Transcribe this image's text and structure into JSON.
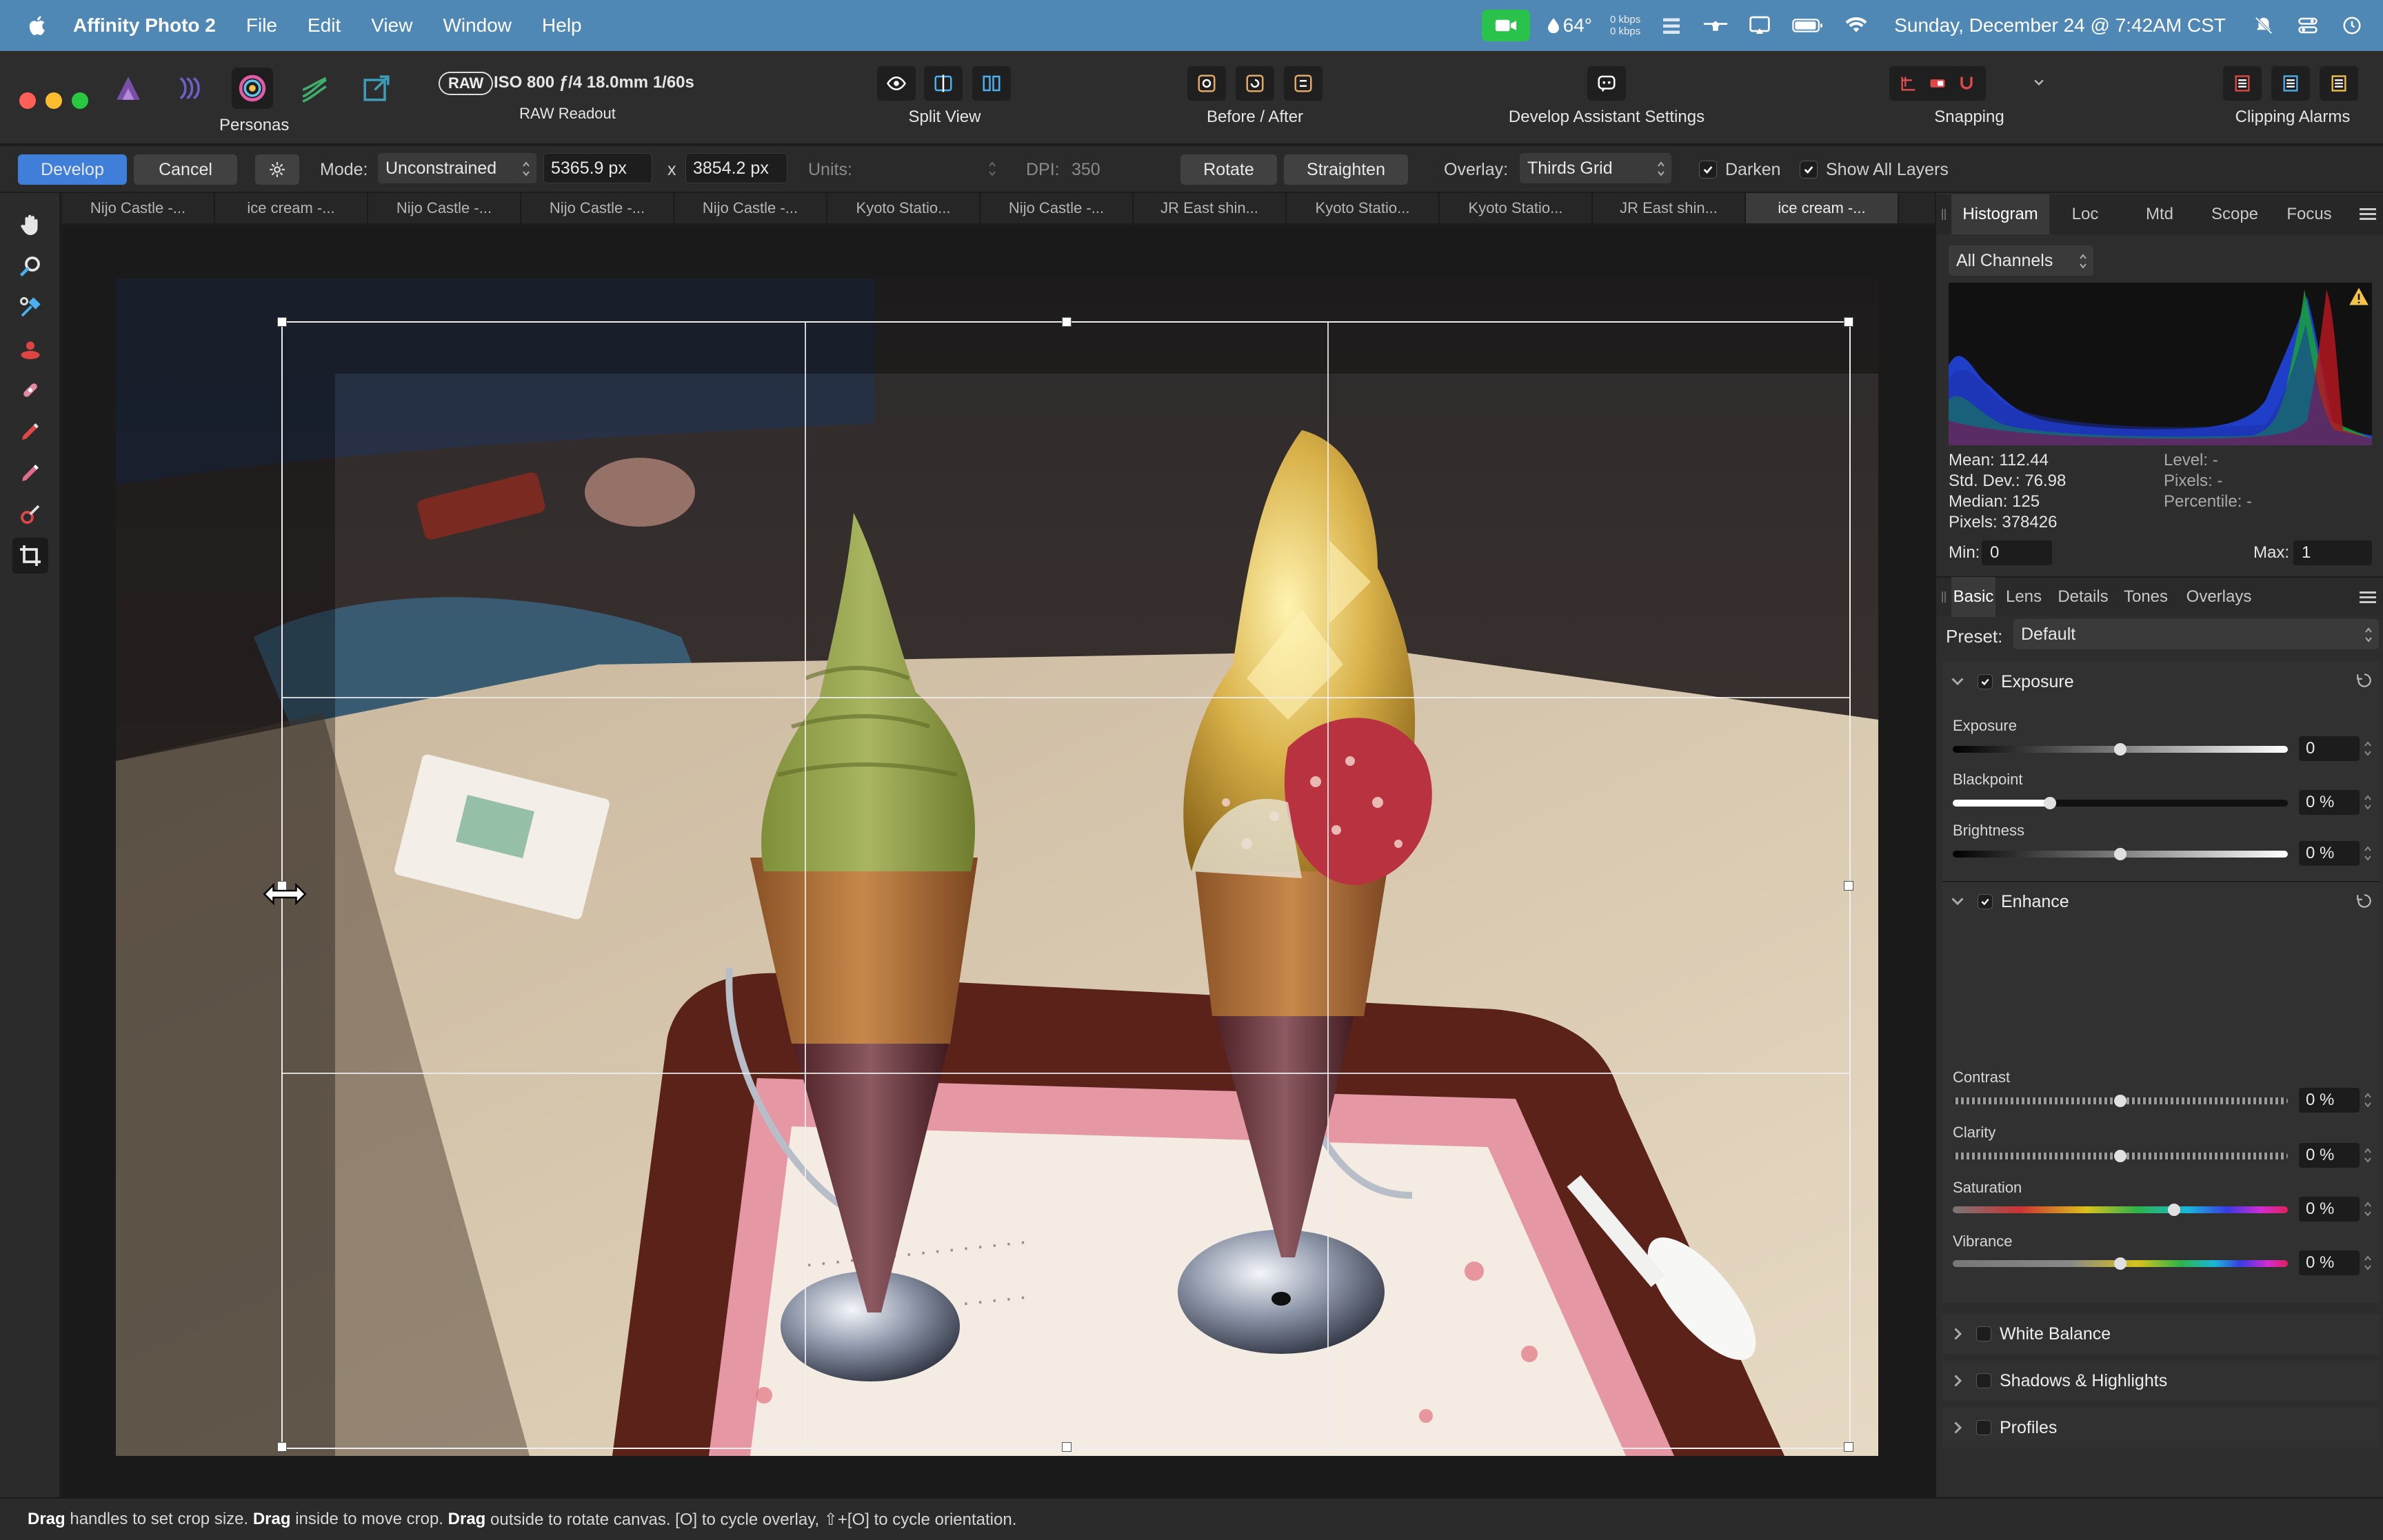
{
  "menubar": {
    "app_name": "Affinity Photo 2",
    "menus": [
      "File",
      "Edit",
      "View",
      "Window",
      "Help"
    ],
    "weather": "64°",
    "net_up": "0 kbps",
    "net_down": "0 kbps",
    "datetime": "Sunday, December 24 @ 7:42AM CST"
  },
  "toolbar": {
    "personas_label": "Personas",
    "raw_badge": "RAW",
    "raw_readout_value": "ISO 800 ƒ/4 18.0mm 1/60s",
    "raw_readout_label": "RAW Readout",
    "split_view_label": "Split View",
    "before_after_label": "Before / After",
    "assistant_label": "Develop Assistant Settings",
    "snapping_label": "Snapping",
    "clipping_label": "Clipping Alarms"
  },
  "context": {
    "develop_label": "Develop",
    "cancel_label": "Cancel",
    "mode_label": "Mode:",
    "mode_value": "Unconstrained",
    "width_value": "5365.9 px",
    "x_label": "x",
    "height_value": "3854.2 px",
    "units_label": "Units:",
    "dpi_label": "DPI:",
    "dpi_value": "350",
    "rotate_label": "Rotate",
    "straighten_label": "Straighten",
    "overlay_label": "Overlay:",
    "overlay_value": "Thirds Grid",
    "darken_label": "Darken",
    "show_layers_label": "Show All Layers"
  },
  "doc_tabs": [
    "Nijo Castle -...",
    "ice cream -...",
    "Nijo Castle -...",
    "Nijo Castle -...",
    "Nijo Castle -...",
    "Kyoto Statio...",
    "Nijo Castle -...",
    "JR East shin...",
    "Kyoto Statio...",
    "Kyoto Statio...",
    "JR East shin...",
    "ice cream -..."
  ],
  "status": {
    "w1": "Drag",
    "t1": " handles to set crop size. ",
    "w2": "Drag",
    "t2": " inside to move crop. ",
    "w3": "Drag",
    "t3": " outside to rotate canvas. [O] to cycle overlay, ⇧+[O] to cycle orientation."
  },
  "histogram": {
    "tabs": [
      "Histogram",
      "Loc",
      "Mtd",
      "Scope",
      "Focus"
    ],
    "channel": "All Channels",
    "mean": "Mean: 112.44",
    "stddev": "Std. Dev.: 76.98",
    "median": "Median: 125",
    "pixels": "Pixels: 378426",
    "level": "Level: -",
    "pixels_right": "Pixels: -",
    "percentile": "Percentile: -",
    "min_label": "Min:",
    "min_value": "0",
    "max_label": "Max:",
    "max_value": "1"
  },
  "develop_panel": {
    "tabs": [
      "Basic",
      "Lens",
      "Details",
      "Tones",
      "Overlays"
    ],
    "preset_label": "Preset:",
    "preset_value": "Default",
    "exposure": {
      "title": "Exposure",
      "sliders": [
        {
          "label": "Exposure",
          "value": "0",
          "pos": 0.5
        },
        {
          "label": "Blackpoint",
          "value": "0 %",
          "pos": 0.29
        },
        {
          "label": "Brightness",
          "value": "0 %",
          "pos": 0.5
        }
      ]
    },
    "enhance": {
      "title": "Enhance",
      "sliders": [
        {
          "label": "Contrast",
          "value": "0 %",
          "pos": 0.5
        },
        {
          "label": "Clarity",
          "value": "0 %",
          "pos": 0.5
        },
        {
          "label": "Saturation",
          "value": "0 %",
          "pos": 0.66
        },
        {
          "label": "Vibrance",
          "value": "0 %",
          "pos": 0.5
        }
      ]
    },
    "collapsed_sections": [
      "White Balance",
      "Shadows & Highlights",
      "Profiles"
    ]
  },
  "colors": {
    "menubar": "#4f87b5",
    "accent": "#3f7fd9",
    "panel": "#2d2d2d"
  }
}
